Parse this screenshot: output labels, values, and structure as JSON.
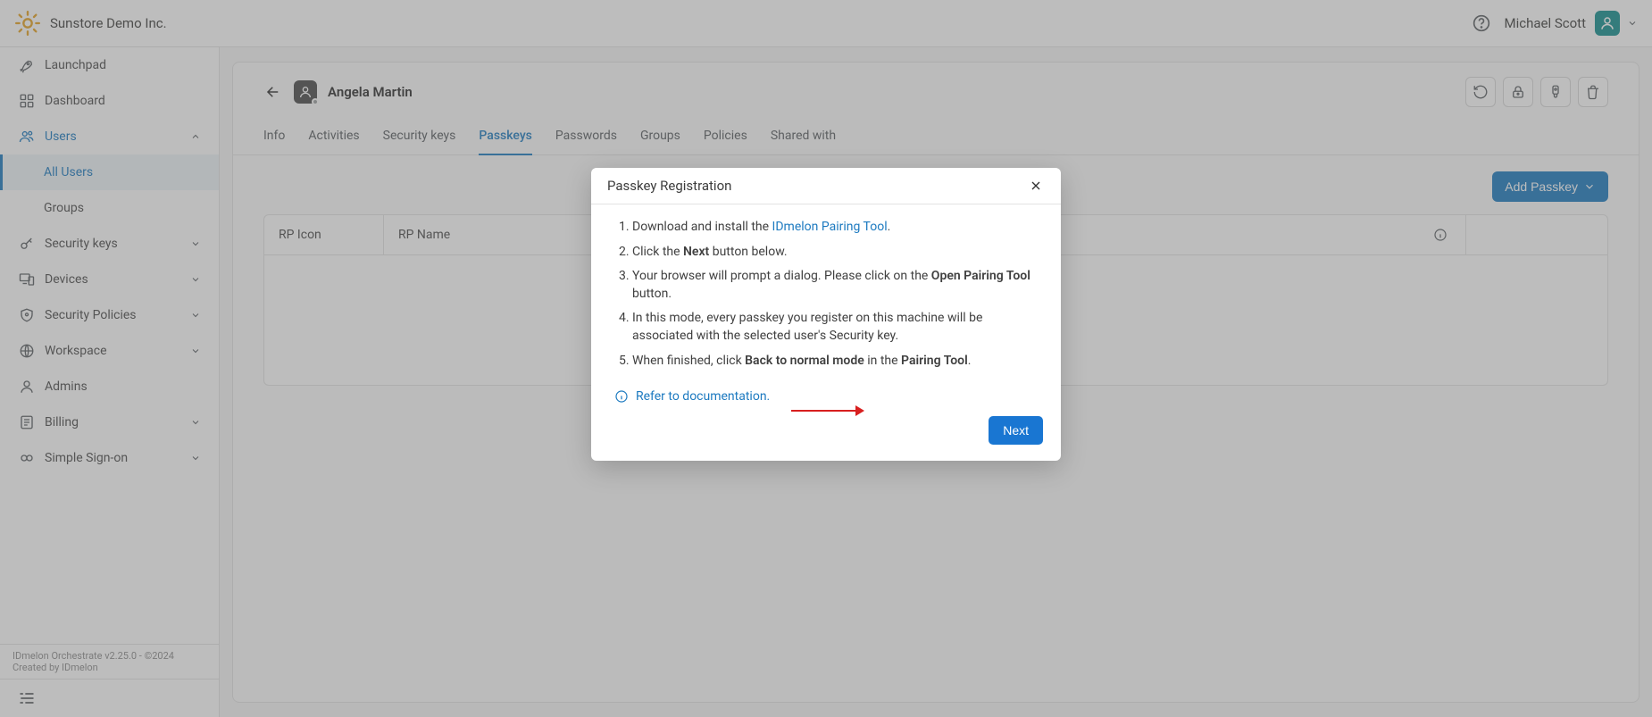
{
  "header": {
    "org": "Sunstore Demo Inc.",
    "user": "Michael Scott"
  },
  "sidebar": {
    "items": [
      {
        "label": "Launchpad"
      },
      {
        "label": "Dashboard"
      },
      {
        "label": "Users"
      },
      {
        "label": "Security keys"
      },
      {
        "label": "Devices"
      },
      {
        "label": "Security Policies"
      },
      {
        "label": "Workspace"
      },
      {
        "label": "Admins"
      },
      {
        "label": "Billing"
      },
      {
        "label": "Simple Sign-on"
      }
    ],
    "sub": {
      "all_users": "All Users",
      "groups": "Groups"
    },
    "footer": "IDmelon Orchestrate v2.25.0 - ©2024 Created by IDmelon"
  },
  "page": {
    "title": "Angela Martin",
    "tabs": [
      "Info",
      "Activities",
      "Security keys",
      "Passkeys",
      "Passwords",
      "Groups",
      "Policies",
      "Shared with"
    ],
    "active_tab": "Passkeys",
    "add_btn": "Add Passkey",
    "cols": {
      "icon": "RP Icon",
      "name": "RP Name",
      "info": ""
    }
  },
  "modal": {
    "title": "Passkey Registration",
    "step1_a": "Download and install the ",
    "step1_link": "IDmelon Pairing Tool",
    "step2_a": "Click the ",
    "step2_b": "Next",
    "step2_c": " button below.",
    "step3_a": "Your browser will prompt a dialog. Please click on the ",
    "step3_b": "Open Pairing Tool",
    "step3_c": " button.",
    "step4": "In this mode, every passkey you register on this machine will be associated with the selected user's Security key.",
    "step5_a": "When finished, click ",
    "step5_b": "Back to normal mode",
    "step5_c": " in the ",
    "step5_d": "Pairing Tool",
    "doc": "Refer to documentation.",
    "next": "Next"
  }
}
